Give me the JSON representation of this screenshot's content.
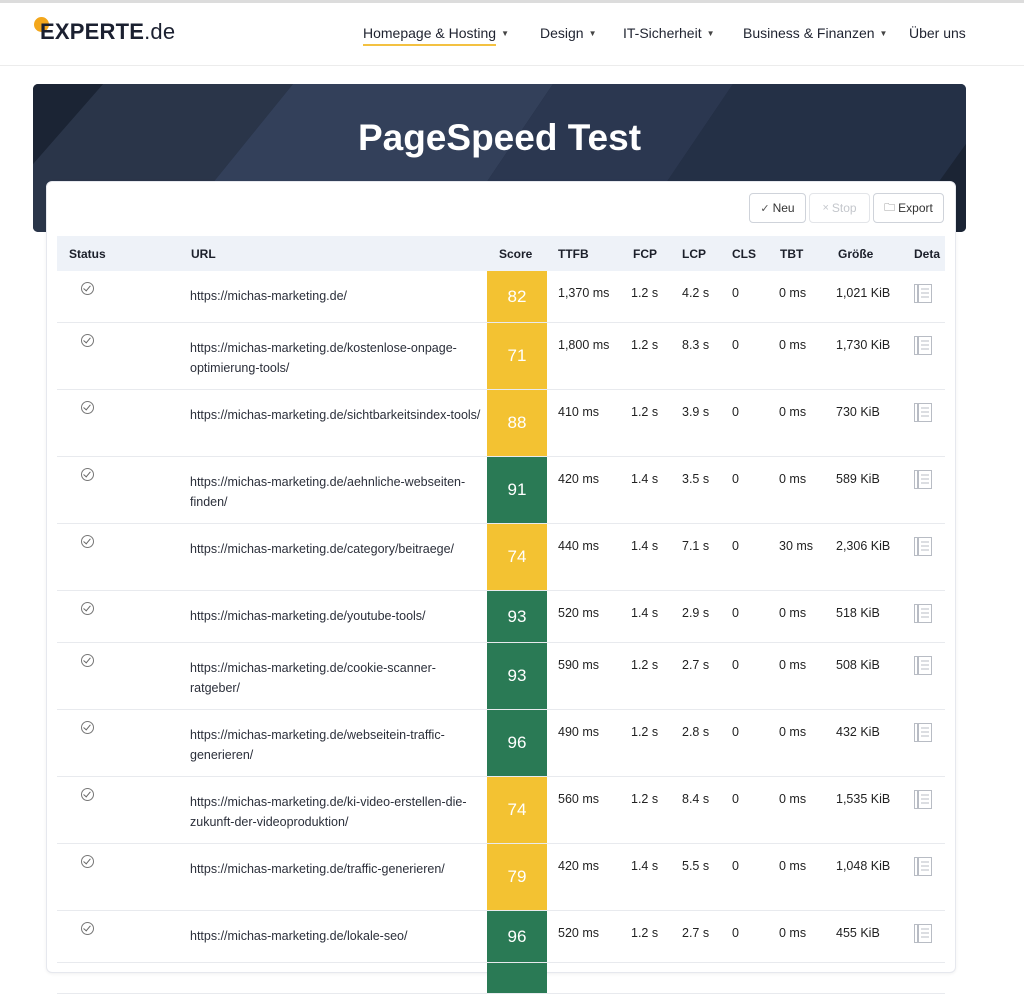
{
  "logo": {
    "bold": "EXPERTE",
    "light": ".de"
  },
  "nav": [
    {
      "label": "Homepage & Hosting",
      "caret": true
    },
    {
      "label": "Design",
      "caret": true
    },
    {
      "label": "IT-Sicherheit",
      "caret": true
    },
    {
      "label": "Business & Finanzen",
      "caret": true
    },
    {
      "label": "Über uns",
      "caret": false
    }
  ],
  "hero": {
    "title": "PageSpeed Test"
  },
  "toolbar": {
    "new_label": "Neu",
    "stop_label": "Stop",
    "export_label": "Export"
  },
  "columns": [
    "Status",
    "URL",
    "Score",
    "TTFB",
    "FCP",
    "LCP",
    "CLS",
    "TBT",
    "Größe",
    "Deta"
  ],
  "rows": [
    {
      "url": "https://michas-marketing.de/",
      "score": "82",
      "tone": "mid",
      "ttfb": "1,370 ms",
      "fcp": "1.2 s",
      "lcp": "4.2 s",
      "cls": "0",
      "tbt": "0 ms",
      "size": "1,021 KiB"
    },
    {
      "url": "https://michas-marketing.de/kostenlose-onpage-optimierung-tools/",
      "score": "71",
      "tone": "mid",
      "ttfb": "1,800 ms",
      "fcp": "1.2 s",
      "lcp": "8.3 s",
      "cls": "0",
      "tbt": "0 ms",
      "size": "1,730 KiB"
    },
    {
      "url": "https://michas-marketing.de/sichtbarkeitsindex-tools/",
      "score": "88",
      "tone": "mid",
      "ttfb": "410 ms",
      "fcp": "1.2 s",
      "lcp": "3.9 s",
      "cls": "0",
      "tbt": "0 ms",
      "size": "730 KiB"
    },
    {
      "url": "https://michas-marketing.de/aehnliche-webseiten-finden/",
      "score": "91",
      "tone": "good",
      "ttfb": "420 ms",
      "fcp": "1.4 s",
      "lcp": "3.5 s",
      "cls": "0",
      "tbt": "0 ms",
      "size": "589 KiB"
    },
    {
      "url": "https://michas-marketing.de/category/beitraege/",
      "score": "74",
      "tone": "mid",
      "ttfb": "440 ms",
      "fcp": "1.4 s",
      "lcp": "7.1 s",
      "cls": "0",
      "tbt": "30 ms",
      "size": "2,306 KiB"
    },
    {
      "url": "https://michas-marketing.de/youtube-tools/",
      "score": "93",
      "tone": "good",
      "ttfb": "520 ms",
      "fcp": "1.4 s",
      "lcp": "2.9 s",
      "cls": "0",
      "tbt": "0 ms",
      "size": "518 KiB"
    },
    {
      "url": "https://michas-marketing.de/cookie-scanner-ratgeber/",
      "score": "93",
      "tone": "good",
      "ttfb": "590 ms",
      "fcp": "1.2 s",
      "lcp": "2.7 s",
      "cls": "0",
      "tbt": "0 ms",
      "size": "508 KiB"
    },
    {
      "url": "https://michas-marketing.de/webseitein-traffic-generieren/",
      "score": "96",
      "tone": "good",
      "ttfb": "490 ms",
      "fcp": "1.2 s",
      "lcp": "2.8 s",
      "cls": "0",
      "tbt": "0 ms",
      "size": "432 KiB"
    },
    {
      "url": "https://michas-marketing.de/ki-video-erstellen-die-zukunft-der-videoproduktion/",
      "score": "74",
      "tone": "mid",
      "ttfb": "560 ms",
      "fcp": "1.2 s",
      "lcp": "8.4 s",
      "cls": "0",
      "tbt": "0 ms",
      "size": "1,535 KiB"
    },
    {
      "url": "https://michas-marketing.de/traffic-generieren/",
      "score": "79",
      "tone": "mid",
      "ttfb": "420 ms",
      "fcp": "1.4 s",
      "lcp": "5.5 s",
      "cls": "0",
      "tbt": "0 ms",
      "size": "1,048 KiB"
    },
    {
      "url": "https://michas-marketing.de/lokale-seo/",
      "score": "96",
      "tone": "good",
      "ttfb": "520 ms",
      "fcp": "1.2 s",
      "lcp": "2.7 s",
      "cls": "0",
      "tbt": "0 ms",
      "size": "455 KiB"
    },
    {
      "url": "",
      "score": "",
      "tone": "good",
      "ttfb": "",
      "fcp": "",
      "lcp": "",
      "cls": "",
      "tbt": "",
      "size": ""
    }
  ],
  "colors": {
    "score_mid": "#f3c232",
    "score_good": "#2a7a55",
    "logo_dot": "#f3a71c",
    "hero_bg": "#1e2839",
    "header_bg": "#eef2f8"
  }
}
